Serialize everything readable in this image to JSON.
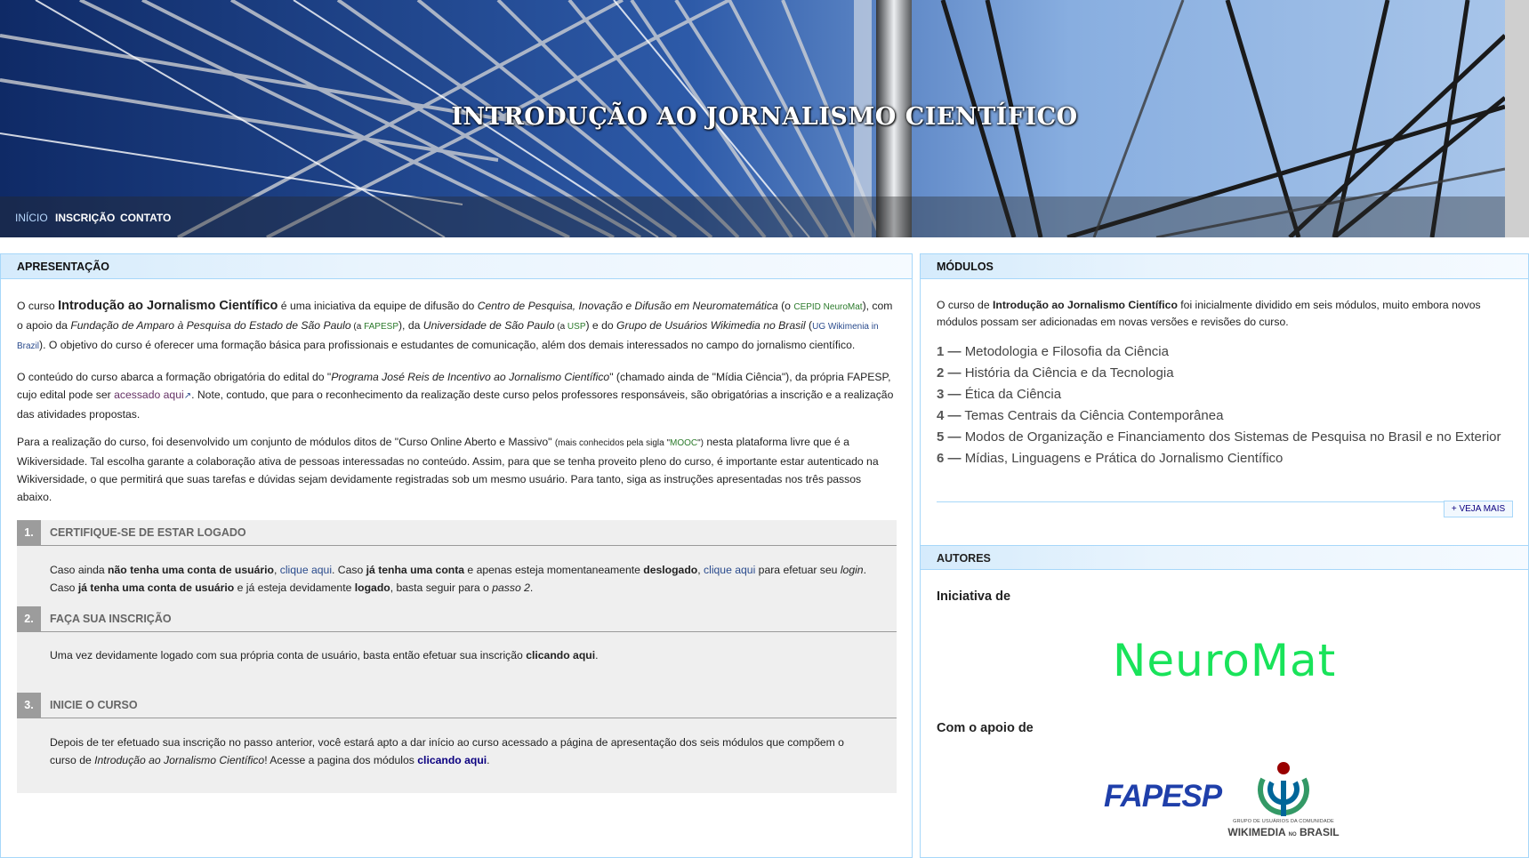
{
  "banner": {
    "title": "INTRODUÇÃO AO JORNALISMO CIENTÍFICO",
    "nav": [
      "INÍCIO",
      "INSCRIÇÃO",
      "CONTATO"
    ]
  },
  "apresentacao": {
    "heading": "APRESENTAÇÃO",
    "p1": {
      "a": "O curso ",
      "course": "Introdução ao Jornalismo Científico",
      "b": " é uma iniciativa da equipe de difusão do ",
      "centro": "Centro de Pesquisa, Inovação e Difusão em Neuromatemática",
      "c": " (o ",
      "cepid": "CEPID NeuroMat",
      "d": "), com o apoio da ",
      "fundacao": "Fundação de Amparo à Pesquisa do Estado de São Paulo",
      "e": " (a ",
      "fapesp": "FAPESP",
      "f": "), da ",
      "univ": "Universidade de São Paulo",
      "g": " (a ",
      "usp": "USP",
      "h": ") e do ",
      "grupo": "Grupo de Usuários Wikimedia no Brasil",
      "i": " (",
      "ug": "UG Wikimenia in Brazil",
      "j": "). O objetivo do curso é oferecer uma formação básica para profissionais e estudantes de comunicação, além dos demais interessados no campo do jornalismo científico."
    },
    "p2": {
      "a": "O conteúdo do curso abarca a formação obrigatória do edital do \"",
      "programa": "Programa José Reis de Incentivo ao Jornalismo Científico",
      "b": "\" (chamado ainda de \"Mídia Ciência\"), da própria FAPESP, cujo edital pode ser ",
      "link": "acessado aqui",
      "c": ". Note, contudo, que para o reconhecimento da realização deste curso pelos professores responsáveis, são obrigatórias a inscrição e a realização das atividades propostas."
    },
    "p3": {
      "a": "Para a realização do curso, foi desenvolvido um conjunto de módulos ditos de \"Curso Online Aberto e Massivo\" ",
      "small_a": "(mais conhecidos pela sigla \"",
      "mooc": "MOOC",
      "small_b": "\")",
      "b": " nesta plataforma livre que é a Wikiversidade. Tal escolha garante a colaboração ativa de pessoas interessadas no conteúdo. Assim, para que se tenha proveito pleno do curso, é importante estar autenticado na Wikiversidade, o que permitirá que suas tarefas e dúvidas sejam devidamente registradas sob um mesmo usuário. Para tanto, siga as instruções apresentadas nos três passos abaixo."
    },
    "steps": [
      {
        "num": "1.",
        "title": "CERTIFIQUE-SE DE ESTAR LOGADO",
        "t1": "Caso ainda ",
        "b1": "não tenha uma conta de usuário",
        "t2": ", ",
        "l1": "clique aqui",
        "t3": ". Caso ",
        "b2": "já tenha uma conta",
        "t4": " e apenas esteja momentaneamente ",
        "b3": "deslogado",
        "t5": ", ",
        "l2": "clique aqui",
        "t6": " para efetuar seu ",
        "i1": "login",
        "t7": ". Caso ",
        "b4": "já tenha uma conta de usuário",
        "t8": " e já esteja devidamente ",
        "b5": "logado",
        "t9": ", basta seguir para o ",
        "i2": "passo 2",
        "t10": "."
      },
      {
        "num": "2.",
        "title": "FAÇA SUA INSCRIÇÃO",
        "t1": "Uma vez devidamente logado com sua própria conta de usuário, basta então efetuar sua inscrição ",
        "b1": "clicando aqui",
        "t2": "."
      },
      {
        "num": "3.",
        "title": "INICIE O CURSO",
        "t1": "Depois de ter efetuado sua inscrição no passo anterior, você estará apto a dar início ao curso acessado a página de apresentação dos seis módulos que compõem o curso de ",
        "i1": "Introdução ao Jornalismo Científico",
        "t2": "! Acesse a pagina dos módulos ",
        "l1": "clicando aqui",
        "t3": "."
      }
    ]
  },
  "modulos": {
    "heading": "MÓDULOS",
    "intro_a": "O curso de ",
    "intro_b": "Introdução ao Jornalismo Científico",
    "intro_c": " foi inicialmente dividido em seis módulos, muito embora novos módulos possam ser adicionadas em novas versões e revisões do curso.",
    "items": [
      {
        "num": "1 —",
        "label": "Metodologia e Filosofia da Ciência"
      },
      {
        "num": "2 —",
        "label": "História da Ciência e da Tecnologia"
      },
      {
        "num": "3 —",
        "label": "Ética da Ciência"
      },
      {
        "num": "4 —",
        "label": "Temas Centrais da Ciência Contemporânea"
      },
      {
        "num": "5 —",
        "label": "Modos de Organização e Financiamento dos Sistemas de Pesquisa no Brasil e no Exterior"
      },
      {
        "num": "6 —",
        "label": "Mídias, Linguagens e Prática do Jornalismo Científico"
      }
    ],
    "more": "+ VEJA MAIS"
  },
  "autores": {
    "heading": "AUTORES",
    "iniciativa": "Iniciativa de",
    "neuromat_logo": "NeuroMat",
    "apoio": "Com o apoio de",
    "fapesp_logo": "FAPESP",
    "wiki_small": "GRUPO DE USUÁRIOS DA COMUNIDADE",
    "wiki_name": "WIKIMEDIA",
    "wiki_no": "NO",
    "wiki_brasil": "BRASIL"
  }
}
